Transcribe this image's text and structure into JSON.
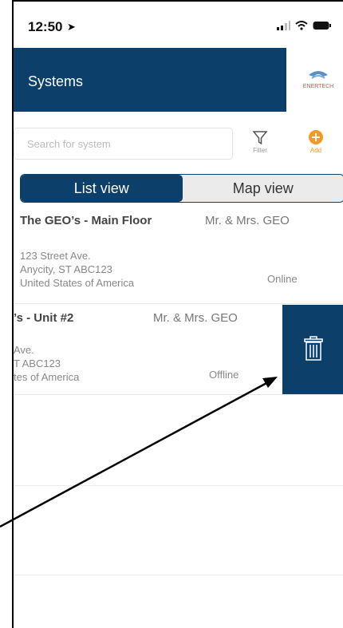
{
  "statusbar": {
    "time": "12:50"
  },
  "header": {
    "title": "Systems",
    "logo_text": "ENERTECH"
  },
  "search": {
    "placeholder": "Search for system"
  },
  "toolbar": {
    "filter_label": "Filter",
    "add_label": "Add"
  },
  "segments": {
    "list": "List view",
    "map": "Map view"
  },
  "systems": [
    {
      "title": "The GEO’s - Main Floor",
      "owner": "Mr. & Mrs. GEO",
      "address": [
        "123 Street Ave.",
        "Anycity, ST ABC123",
        "United States of America"
      ],
      "status": "Online"
    },
    {
      "title": "’s - Unit #2",
      "owner": "Mr. & Mrs. GEO",
      "address": [
        "Ave.",
        "T ABC123",
        "tes of America"
      ],
      "status": "Offline"
    }
  ],
  "colors": {
    "brand": "#0d3f6b",
    "accent": "#f39a2b"
  },
  "icons": {
    "delete": "trash-icon",
    "filter": "filter-icon",
    "add": "plus-circle-icon"
  }
}
